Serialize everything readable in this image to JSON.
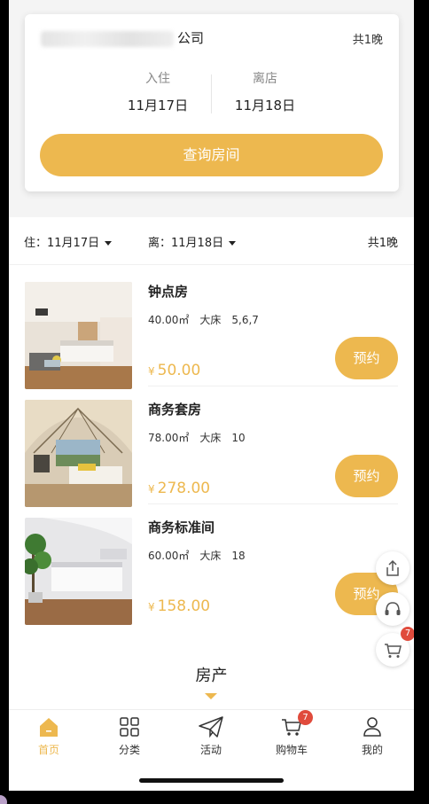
{
  "search_card": {
    "company_name": "公司",
    "nights": "共1晚",
    "checkin_label": "入住",
    "checkin_date": "11月17日",
    "checkout_label": "离店",
    "checkout_date": "11月18日",
    "search_button": "查询房间"
  },
  "filter_bar": {
    "checkin": "住：11月17日",
    "checkout": "离：11月18日",
    "nights": "共1晚"
  },
  "rooms": [
    {
      "name": "钟点房",
      "area": "40.00㎡",
      "bed": "大床",
      "info": "5,6,7",
      "currency": "¥",
      "price": "50.00",
      "book_label": "预约"
    },
    {
      "name": "商务套房",
      "area": "78.00㎡",
      "bed": "大床",
      "info": "10",
      "currency": "¥",
      "price": "278.00",
      "book_label": "预约"
    },
    {
      "name": "商务标准间",
      "area": "60.00㎡",
      "bed": "大床",
      "info": "18",
      "currency": "¥",
      "price": "158.00",
      "book_label": "预约"
    }
  ],
  "section_title": "房产",
  "floating": {
    "cart_badge": "7"
  },
  "tabbar": {
    "tabs": [
      {
        "label": "首页",
        "icon": "home-icon",
        "active": true
      },
      {
        "label": "分类",
        "icon": "grid-icon"
      },
      {
        "label": "活动",
        "icon": "paper-plane-icon"
      },
      {
        "label": "购物车",
        "icon": "cart-icon",
        "badge": "7"
      },
      {
        "label": "我的",
        "icon": "user-icon"
      }
    ]
  },
  "colors": {
    "accent": "#EDB84F",
    "badge": "#E04B3C"
  }
}
